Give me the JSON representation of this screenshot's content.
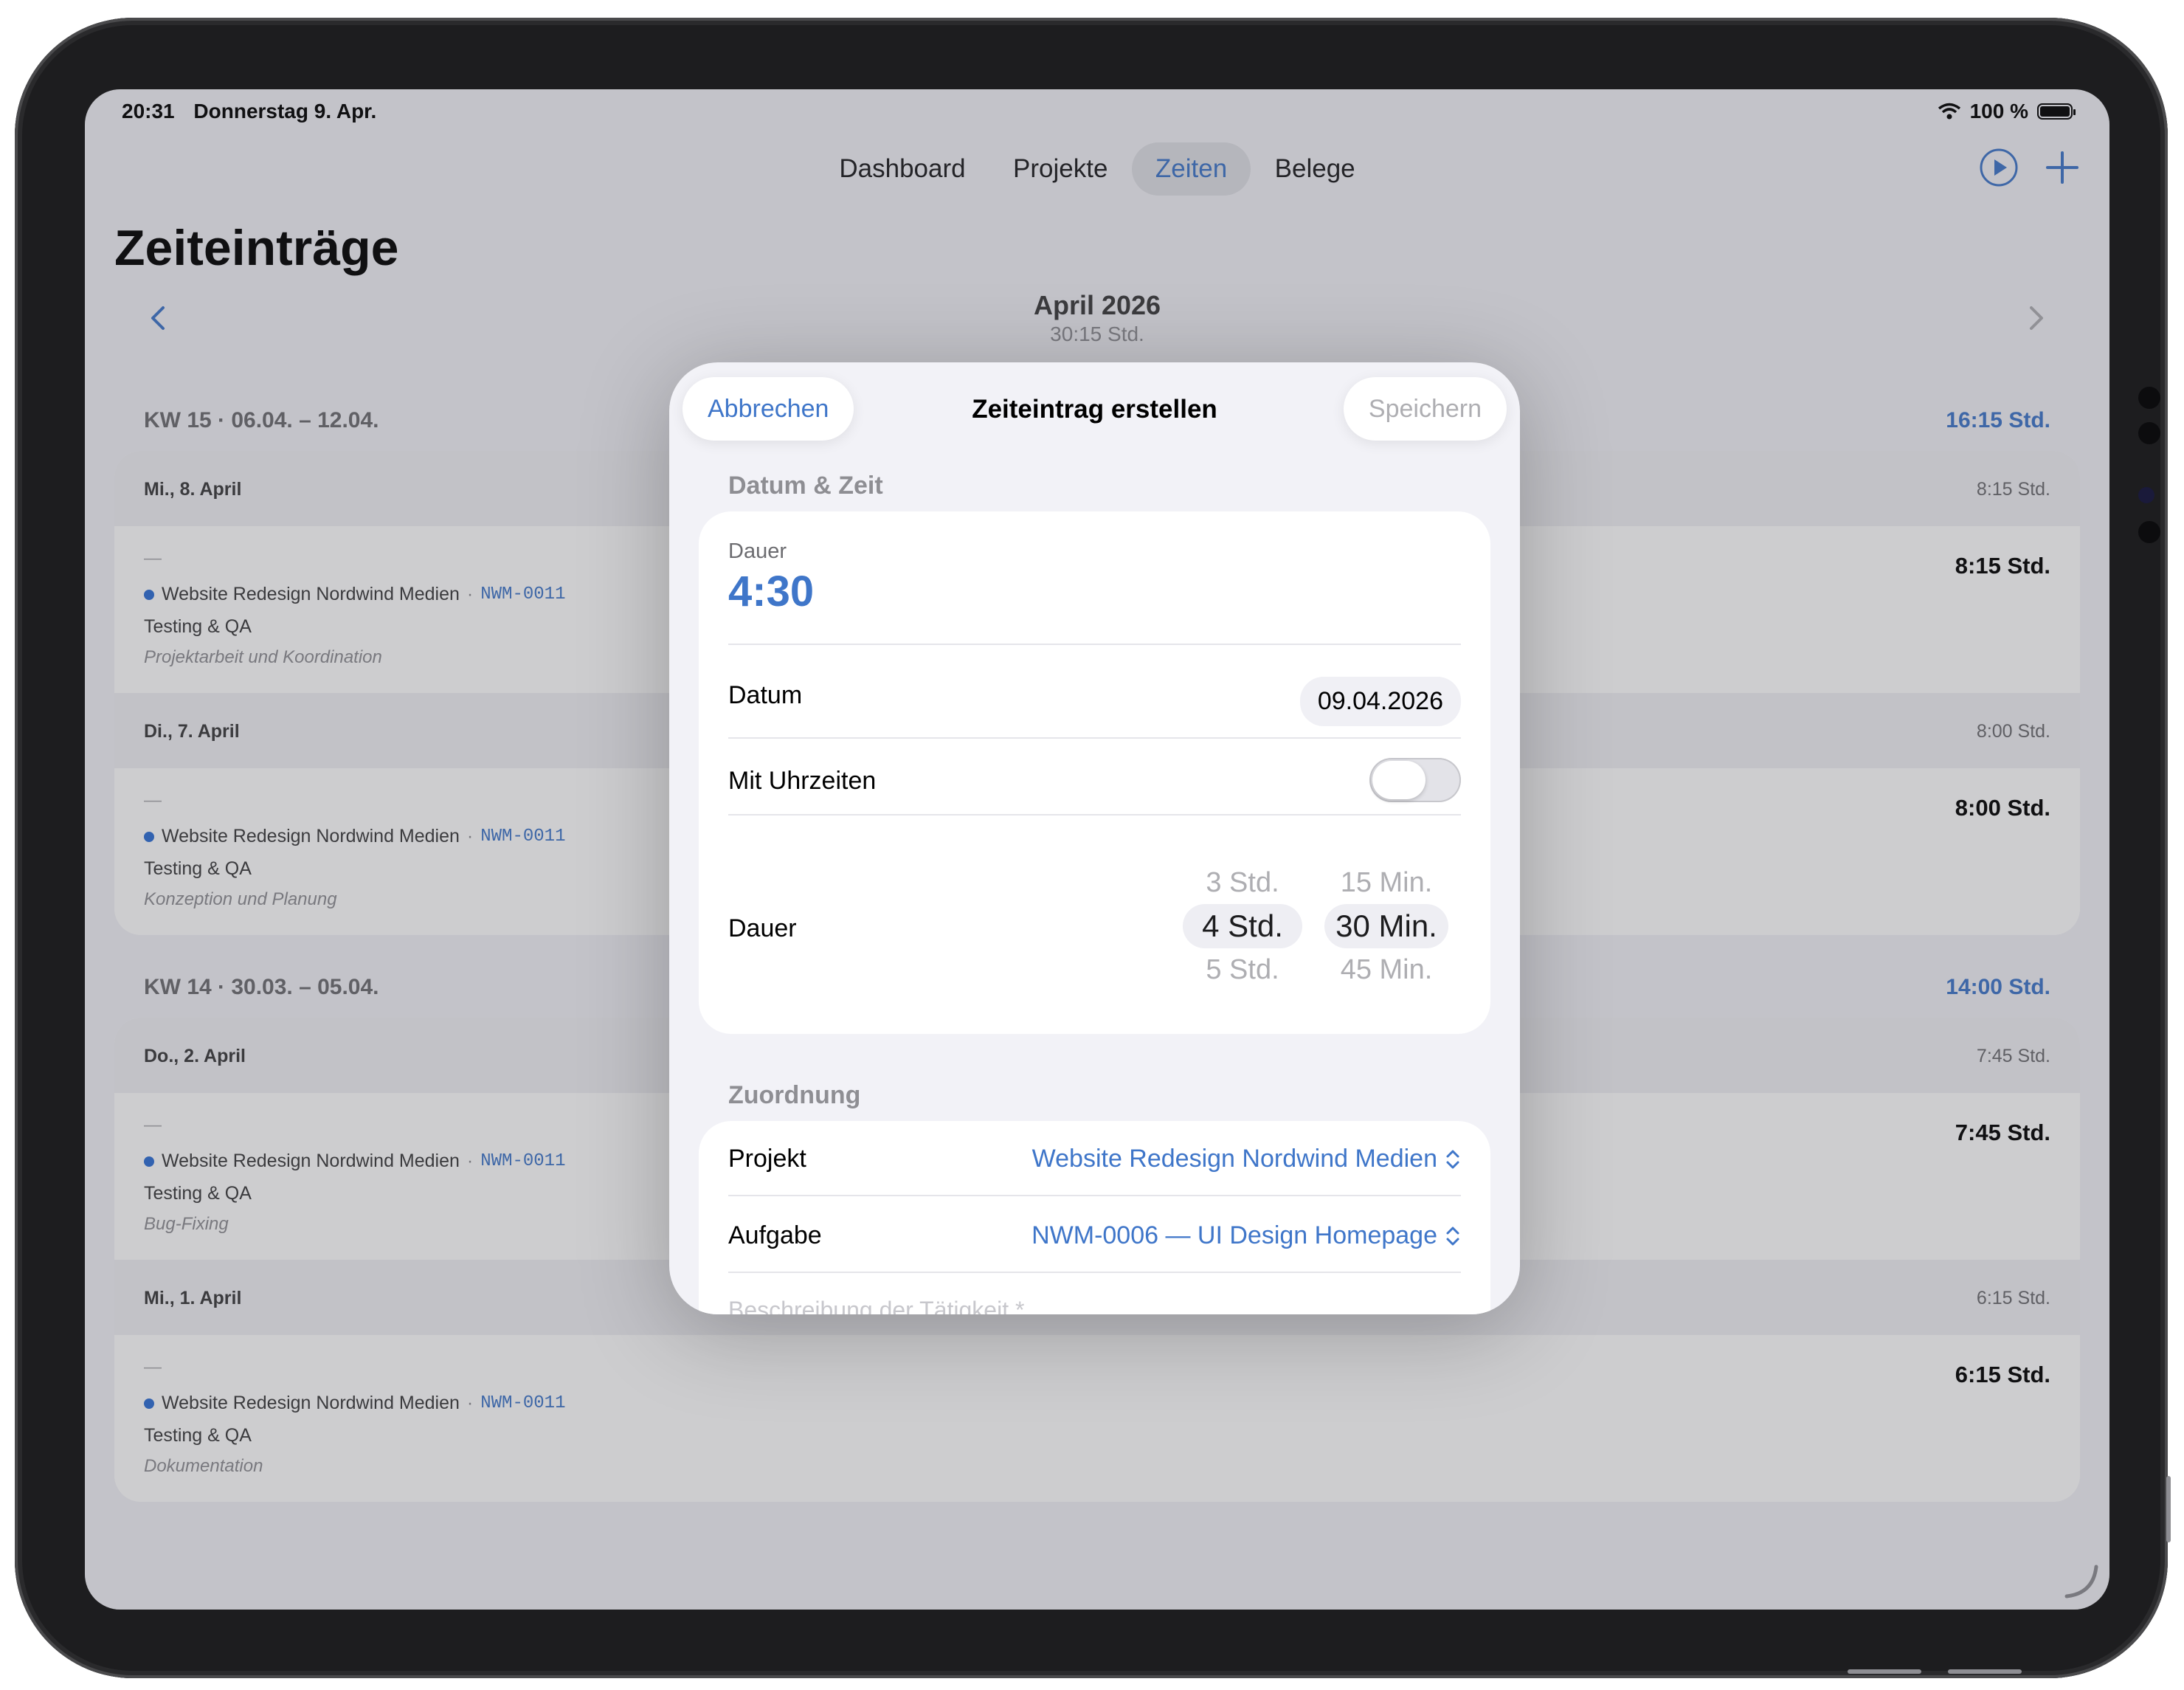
{
  "status": {
    "time": "20:31",
    "date": "Donnerstag 9. Apr.",
    "battery": "100 %"
  },
  "tabs": [
    {
      "label": "Dashboard"
    },
    {
      "label": "Projekte"
    },
    {
      "label": "Zeiten"
    },
    {
      "label": "Belege"
    }
  ],
  "active_tab": "Zeiten",
  "page": {
    "title": "Zeiteinträge"
  },
  "month": {
    "title": "April 2026",
    "total": "30:15 Std."
  },
  "weeks": [
    {
      "label": "KW 15 · 06.04. – 12.04.",
      "total": "16:15 Std.",
      "days": [
        {
          "day": "Mi., 8. April",
          "day_total": "8:15 Std.",
          "dash": "—",
          "project": "Website Redesign Nordwind Medien",
          "sep": "·",
          "code": "NWM-0011",
          "task": "Testing & QA",
          "note": "Projektarbeit und Koordination",
          "hours": "8:15 Std."
        },
        {
          "day": "Di., 7. April",
          "day_total": "8:00 Std.",
          "dash": "—",
          "project": "Website Redesign Nordwind Medien",
          "sep": "·",
          "code": "NWM-0011",
          "task": "Testing & QA",
          "note": "Konzeption und Planung",
          "hours": "8:00 Std."
        }
      ]
    },
    {
      "label": "KW 14 · 30.03. – 05.04.",
      "total": "14:00 Std.",
      "days": [
        {
          "day": "Do., 2. April",
          "day_total": "7:45 Std.",
          "dash": "—",
          "project": "Website Redesign Nordwind Medien",
          "sep": "·",
          "code": "NWM-0011",
          "task": "Testing & QA",
          "note": "Bug-Fixing",
          "hours": "7:45 Std."
        },
        {
          "day": "Mi., 1. April",
          "day_total": "6:15 Std.",
          "dash": "—",
          "project": "Website Redesign Nordwind Medien",
          "sep": "·",
          "code": "NWM-0011",
          "task": "Testing & QA",
          "note": "Dokumentation",
          "hours": "6:15 Std."
        }
      ]
    }
  ],
  "modal": {
    "cancel_label": "Abbrechen",
    "title": "Zeiteintrag erstellen",
    "save_label": "Speichern",
    "section_datetime": "Datum & Zeit",
    "duration_label": "Dauer",
    "duration_value": "4:30",
    "date_label": "Datum",
    "date_value": "09.04.2026",
    "times_label": "Mit Uhrzeiten",
    "times_enabled": false,
    "picker_label": "Dauer",
    "hours_options": [
      "3 Std.",
      "4 Std.",
      "5 Std."
    ],
    "minutes_options": [
      "15 Min.",
      "30 Min.",
      "45 Min."
    ],
    "section_assignment": "Zuordnung",
    "project_label": "Projekt",
    "project_value": "Website Redesign Nordwind Medien",
    "task_label": "Aufgabe",
    "task_value": "NWM-0006 — UI Design Homepage",
    "description_placeholder": "Beschreibung der Tätigkeit *"
  },
  "colors": {
    "accent": "#3f76c9",
    "background": "#f2f2f7",
    "card": "#ffffff"
  }
}
